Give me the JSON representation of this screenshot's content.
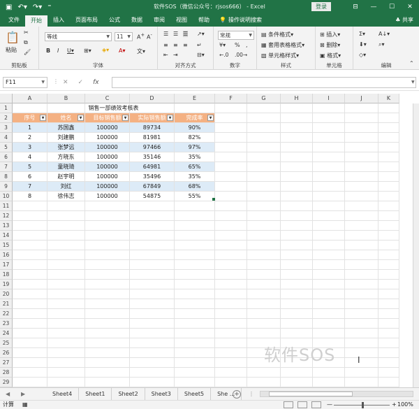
{
  "window": {
    "title": "软件SOS（微信公众号：rjsos666） - Excel",
    "login_label": "登录",
    "share_label": "♣ 共享",
    "minimize": "—",
    "maximize": "☐",
    "close": "✕"
  },
  "ribbon_tabs": [
    "文件",
    "开始",
    "插入",
    "页面布局",
    "公式",
    "数据",
    "审阅",
    "视图",
    "帮助"
  ],
  "search_label": "操作说明搜索",
  "ribbon": {
    "paste_label": "粘贴",
    "clipboard_label": "剪贴板",
    "font_name": "等线",
    "font_size": "11",
    "font_label": "字体",
    "align_label": "对齐方式",
    "number_format": "常规",
    "number_label": "数字",
    "cond_format": "条件格式",
    "table_format": "套用表格格式",
    "cell_style": "单元格样式",
    "styles_label": "样式",
    "insert": "插入",
    "delete": "删除",
    "format": "格式",
    "cells_label": "单元格",
    "editing_label": "编辑"
  },
  "formula_bar": {
    "name_box": "F11",
    "cancel": "✕",
    "confirm": "✓",
    "fx": "fx",
    "value": ""
  },
  "columns": [
    "A",
    "B",
    "C",
    "D",
    "E",
    "F",
    "G",
    "H",
    "I",
    "J",
    "K"
  ],
  "rows": [
    "1",
    "2",
    "3",
    "4",
    "5",
    "6",
    "7",
    "8",
    "9",
    "10",
    "11",
    "12",
    "13",
    "14",
    "15",
    "16",
    "17",
    "18",
    "19",
    "20",
    "21",
    "22",
    "23",
    "24",
    "25",
    "26",
    "27",
    "28",
    "29"
  ],
  "sheet": {
    "title": "销售一部绩效考核表",
    "headers": [
      "序号",
      "姓名",
      "目标销售额",
      "实际销售额",
      "完成率"
    ],
    "data": [
      [
        "1",
        "苏国鑫",
        "100000",
        "89734",
        "90%"
      ],
      [
        "2",
        "刘建鹏",
        "100000",
        "81981",
        "82%"
      ],
      [
        "3",
        "张梦远",
        "100000",
        "97466",
        "97%"
      ],
      [
        "4",
        "方晓东",
        "100000",
        "35146",
        "35%"
      ],
      [
        "5",
        "童晓琦",
        "100000",
        "64981",
        "65%"
      ],
      [
        "6",
        "赵宇明",
        "100000",
        "35496",
        "35%"
      ],
      [
        "7",
        "刘红",
        "100000",
        "67849",
        "68%"
      ],
      [
        "8",
        "徐伟志",
        "100000",
        "54875",
        "55%"
      ]
    ]
  },
  "watermark": "软件SOS",
  "sheet_tabs": [
    "Sheet4",
    "Sheet1",
    "Sheet2",
    "Sheet3",
    "Sheet5",
    "She ..."
  ],
  "status": {
    "mode": "计算",
    "zoom": "100%",
    "zoom_minus": "—",
    "zoom_plus": "+"
  }
}
